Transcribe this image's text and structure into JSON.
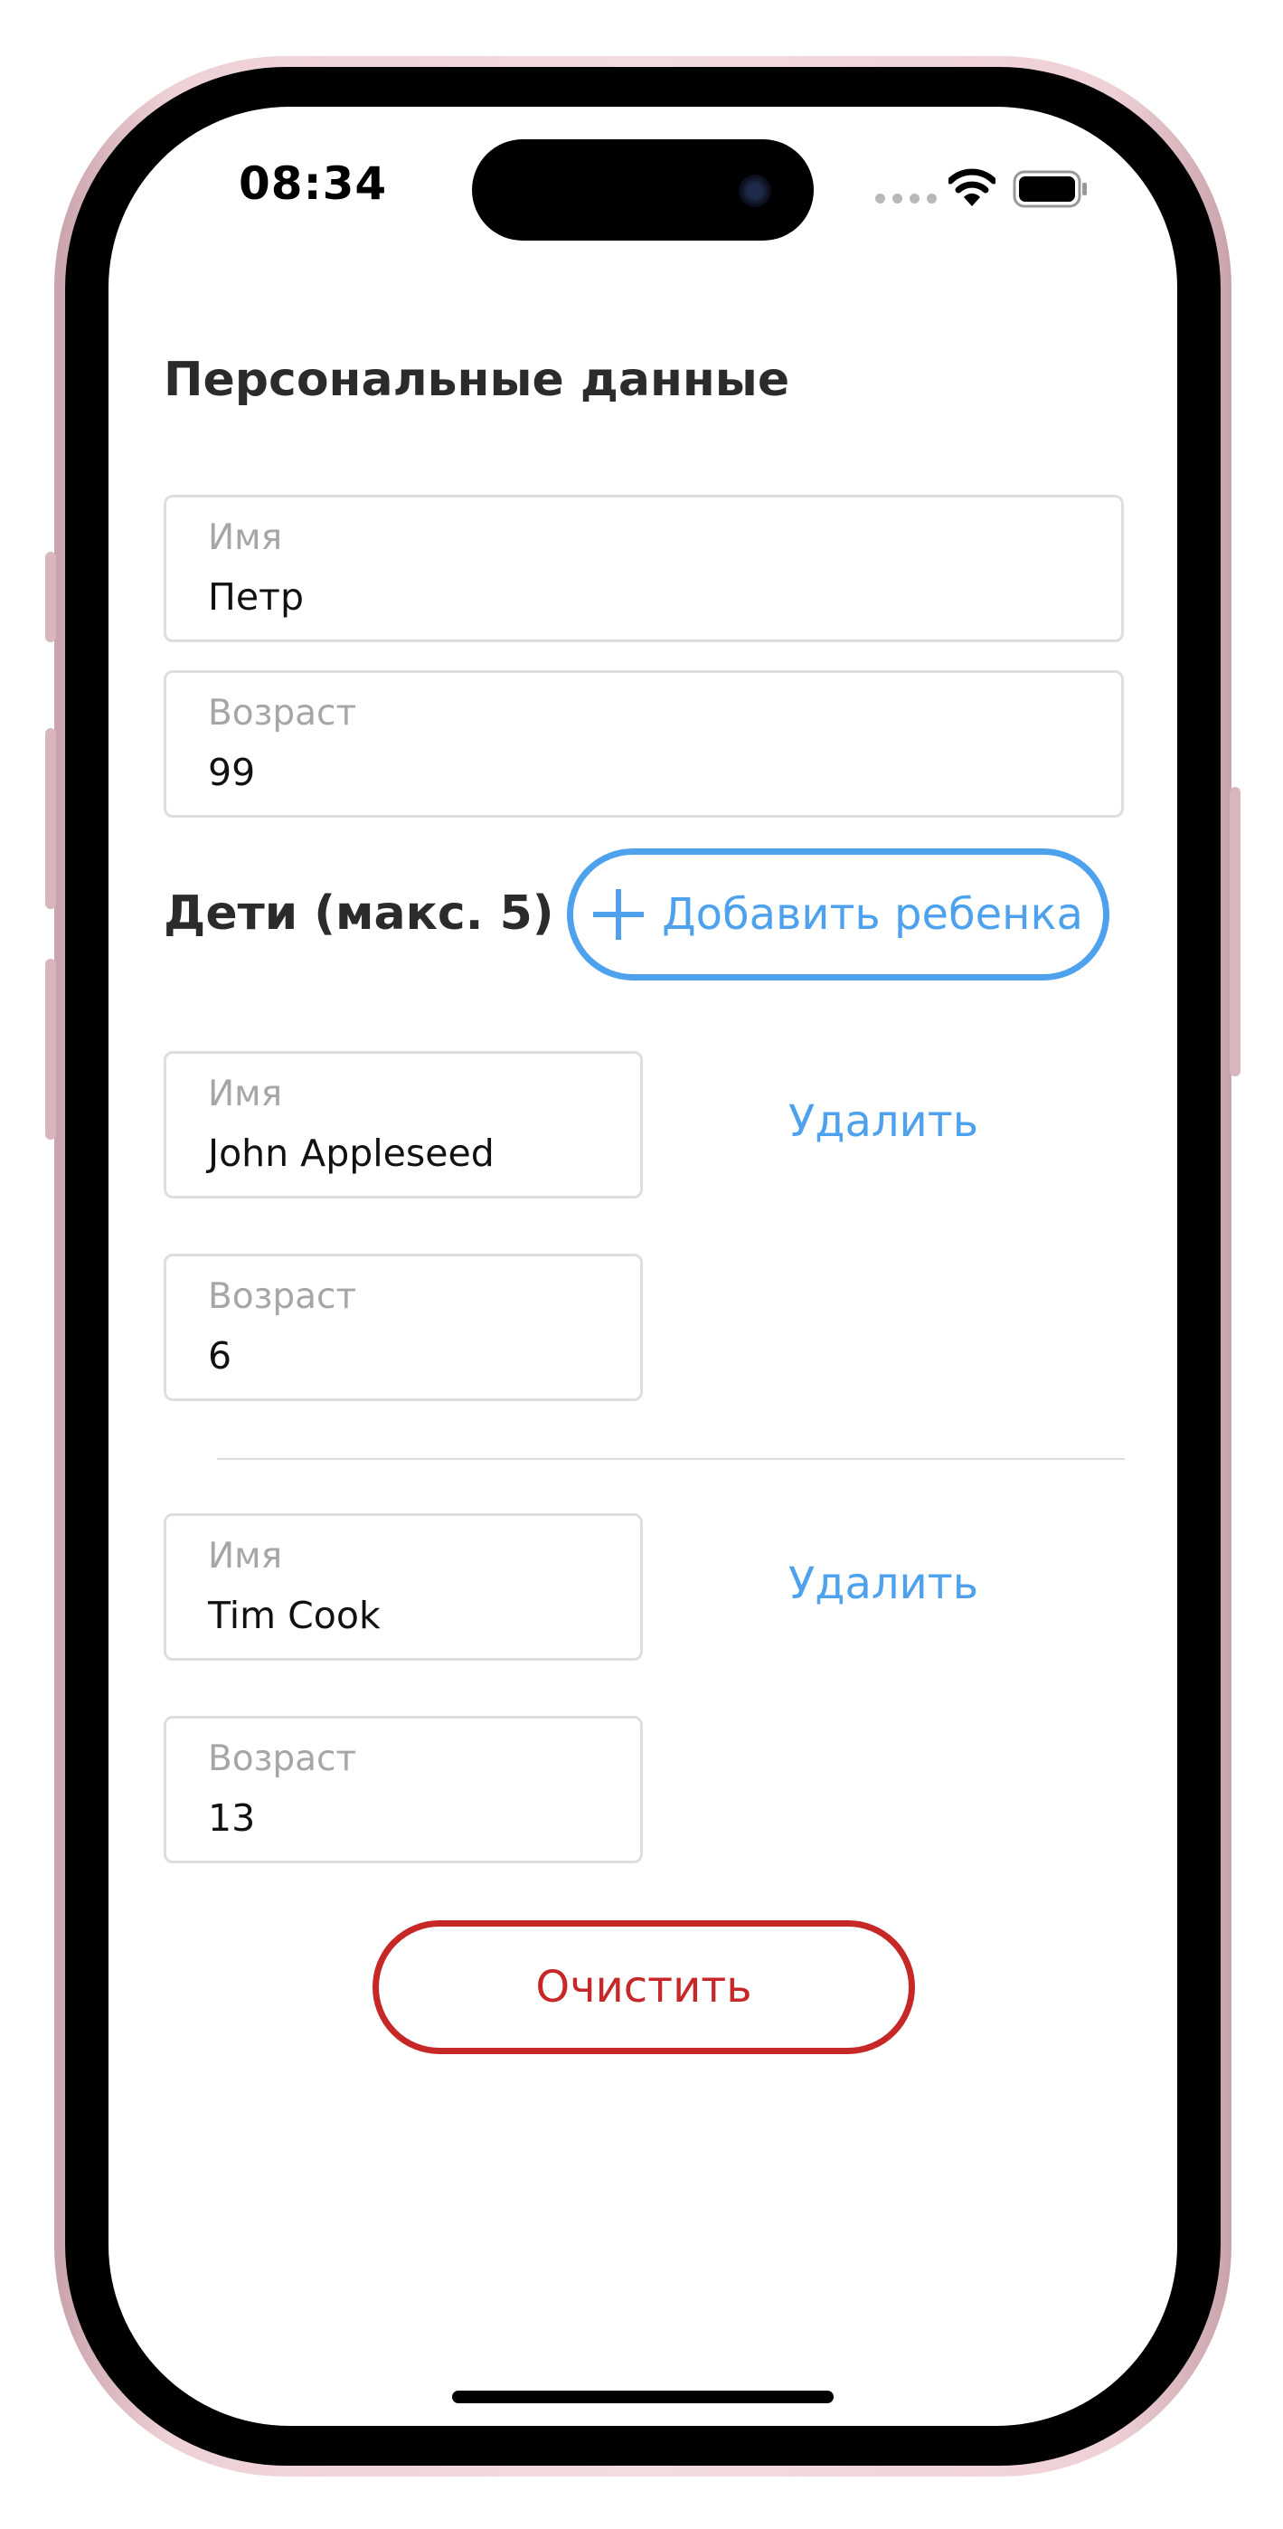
{
  "status_bar": {
    "time": "08:34"
  },
  "personal": {
    "title": "Персональные данные",
    "name_field": {
      "label": "Имя",
      "value": "Петр"
    },
    "age_field": {
      "label": "Возраст",
      "value": "99"
    }
  },
  "children": {
    "title": "Дети (макс. 5)",
    "add_button_label": "Добавить ребенка",
    "items": [
      {
        "name_label": "Имя",
        "name_value": "John Appleseed",
        "age_label": "Возраст",
        "age_value": "6",
        "delete_label": "Удалить"
      },
      {
        "name_label": "Имя",
        "name_value": "Tim Cook",
        "age_label": "Возраст",
        "age_value": "13",
        "delete_label": "Удалить"
      }
    ]
  },
  "clear_button_label": "Очистить",
  "colors": {
    "accent": "#4ea1ec",
    "danger": "#c62828",
    "field_border": "#dedede",
    "label_gray": "#a6a6a6"
  }
}
